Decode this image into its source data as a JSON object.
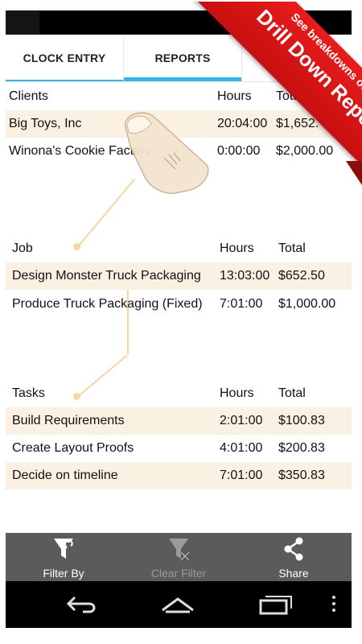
{
  "tabs": [
    {
      "label": "CLOCK ENTRY"
    },
    {
      "label": "REPORTS"
    }
  ],
  "ribbon": {
    "subtitle": "See breakdowns of work",
    "title": "Drill Down Reports",
    "color": "#d91414"
  },
  "clients": {
    "headers": [
      "Clients",
      "Hours",
      "Total"
    ],
    "rows": [
      {
        "name": "Big Toys, Inc",
        "hours": "20:04:00",
        "total": "$1,652."
      },
      {
        "name": "Winona's Cookie Factory",
        "hours": "0:00:00",
        "total": "$2,000.00"
      }
    ]
  },
  "jobs": {
    "headers": [
      "Job",
      "Hours",
      "Total"
    ],
    "rows": [
      {
        "name": "Design Monster Truck Packaging",
        "hours": "13:03:00",
        "total": "$652.50"
      },
      {
        "name": "Produce Truck Packaging (Fixed)",
        "hours": "7:01:00",
        "total": "$1,000.00"
      }
    ]
  },
  "tasks": {
    "headers": [
      "Tasks",
      "Hours",
      "Total"
    ],
    "rows": [
      {
        "name": "Build Requirements",
        "hours": "2:01:00",
        "total": "$100.83"
      },
      {
        "name": "Create Layout Proofs",
        "hours": "4:01:00",
        "total": "$200.83"
      },
      {
        "name": "Decide on timeline",
        "hours": "7:01:00",
        "total": "$350.83"
      }
    ]
  },
  "actions": [
    {
      "label": "Filter By",
      "icon": "filter-icon",
      "enabled": true
    },
    {
      "label": "Clear Filter",
      "icon": "clear-filter-icon",
      "enabled": false
    },
    {
      "label": "Share",
      "icon": "share-icon",
      "enabled": true
    }
  ],
  "nav": [
    "back-icon",
    "home-icon",
    "recent-apps-icon",
    "overflow-menu-icon"
  ],
  "colors": {
    "accent": "#33b5e5",
    "row_highlight": "#fbf1e3",
    "action_bar": "#5b5b5b",
    "disabled_text": "#9a9a9a"
  }
}
